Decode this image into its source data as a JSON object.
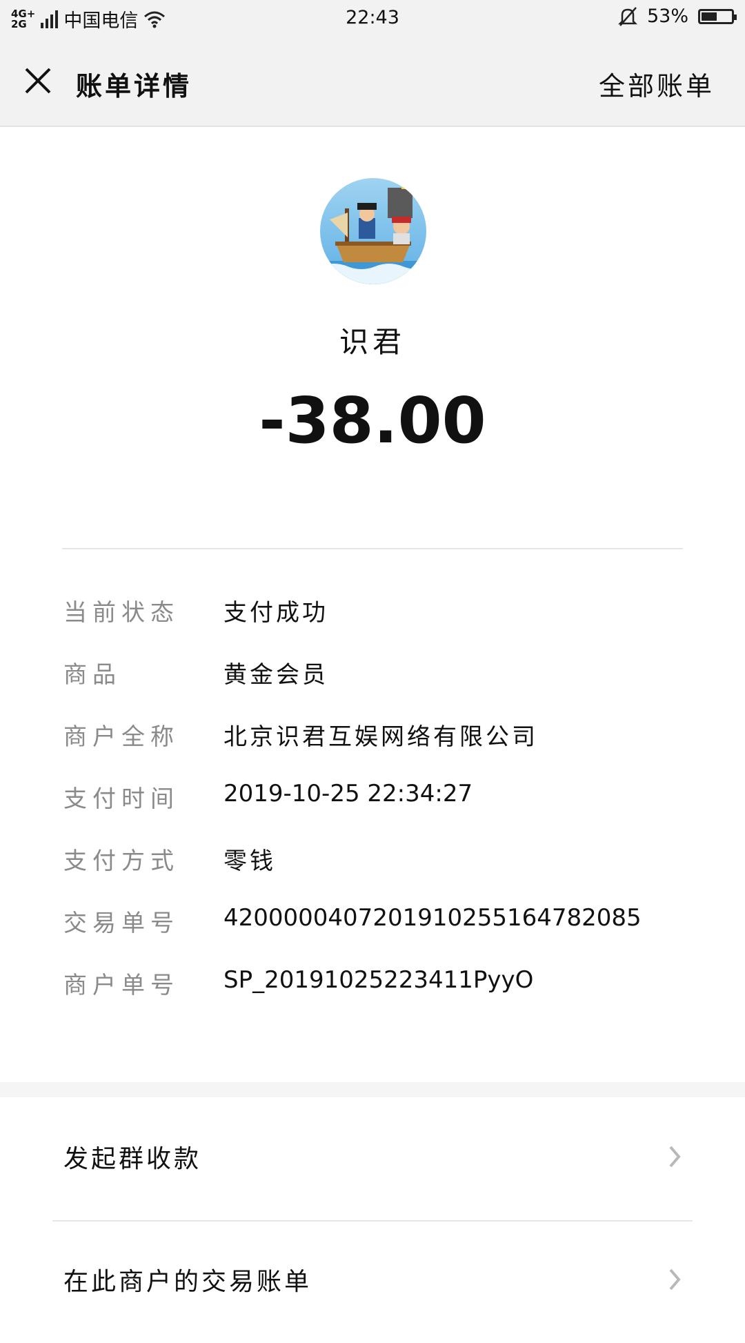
{
  "status_bar": {
    "network_top": "4G+",
    "network_bottom": "2G",
    "carrier": "中国电信",
    "time": "22:43",
    "battery_percent": "53%",
    "battery_level": 0.53
  },
  "nav": {
    "title": "账单详情",
    "right_link": "全部账单"
  },
  "merchant": {
    "name": "识君",
    "amount": "-38.00"
  },
  "details": [
    {
      "label": "当前状态",
      "value": "支付成功"
    },
    {
      "label": "商品",
      "value": "黄金会员"
    },
    {
      "label": "商户全称",
      "value": "北京识君互娱网络有限公司"
    },
    {
      "label": "支付时间",
      "value": "2019-10-25 22:34:27"
    },
    {
      "label": "支付方式",
      "value": "零钱"
    },
    {
      "label": "交易单号",
      "value": "4200000407201910255164782085"
    },
    {
      "label": "商户单号",
      "value": "SP_20191025223411PyyO"
    }
  ],
  "actions": [
    {
      "label": "发起群收款"
    },
    {
      "label": "在此商户的交易账单"
    }
  ],
  "colors": {
    "bar_bg": "#f2f2f2",
    "label_gray": "#8a8a8a",
    "divider": "#e6e6e6"
  }
}
